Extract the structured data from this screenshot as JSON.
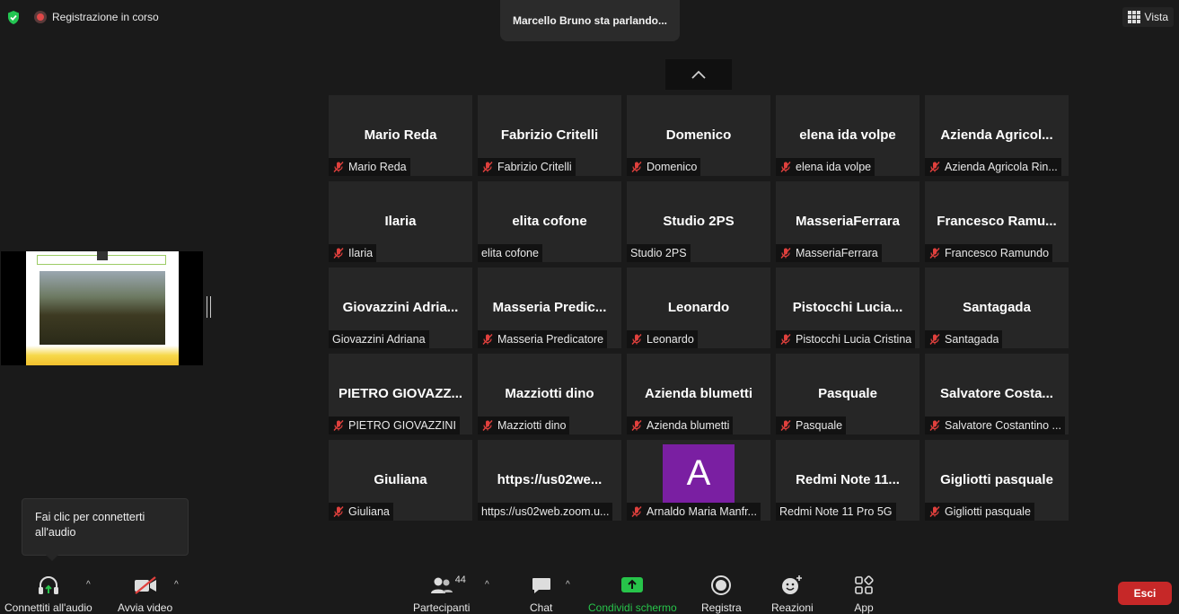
{
  "header": {
    "recording_label": "Registrazione in corso",
    "speaking_banner": "Marcello Bruno sta parlando...",
    "view_label": "Vista"
  },
  "tiles": [
    {
      "big": "Mario Reda",
      "label": "Mario Reda",
      "muted": true
    },
    {
      "big": "Fabrizio Critelli",
      "label": "Fabrizio Critelli",
      "muted": true
    },
    {
      "big": "Domenico",
      "label": "Domenico",
      "muted": true
    },
    {
      "big": "elena ida volpe",
      "label": "elena ida volpe",
      "muted": true
    },
    {
      "big": "Azienda Agricol...",
      "label": "Azienda Agricola Rin...",
      "muted": true
    },
    {
      "big": "Ilaria",
      "label": "Ilaria",
      "muted": true
    },
    {
      "big": "elita cofone",
      "label": "elita cofone",
      "muted": false
    },
    {
      "big": "Studio 2PS",
      "label": "Studio 2PS",
      "muted": false
    },
    {
      "big": "MasseriaFerrara",
      "label": "MasseriaFerrara",
      "muted": true
    },
    {
      "big": "Francesco Ramu...",
      "label": "Francesco Ramundo",
      "muted": true
    },
    {
      "big": "Giovazzini Adria...",
      "label": "Giovazzini Adriana",
      "muted": false
    },
    {
      "big": "Masseria Predic...",
      "label": "Masseria Predicatore",
      "muted": true
    },
    {
      "big": "Leonardo",
      "label": "Leonardo",
      "muted": true
    },
    {
      "big": "Pistocchi Lucia...",
      "label": "Pistocchi Lucia Cristina",
      "muted": true
    },
    {
      "big": "Santagada",
      "label": "Santagada",
      "muted": true
    },
    {
      "big": "PIETRO GIOVAZZ...",
      "label": "PIETRO GIOVAZZINI",
      "muted": true
    },
    {
      "big": "Mazziotti dino",
      "label": "Mazziotti dino",
      "muted": true
    },
    {
      "big": "Azienda blumetti",
      "label": "Azienda blumetti",
      "muted": true
    },
    {
      "big": "Pasquale",
      "label": "Pasquale",
      "muted": true
    },
    {
      "big": "Salvatore Costa...",
      "label": "Salvatore Costantino ...",
      "muted": true
    },
    {
      "big": "Giuliana",
      "label": "Giuliana",
      "muted": true
    },
    {
      "big": "https://us02we...",
      "label": "https://us02web.zoom.u...",
      "muted": false
    },
    {
      "big": "",
      "avatar": "A",
      "label": "Arnaldo Maria Manfr...",
      "muted": true
    },
    {
      "big": "Redmi Note 11...",
      "label": "Redmi Note 11 Pro 5G",
      "muted": false
    },
    {
      "big": "Gigliotti pasquale",
      "label": "Gigliotti pasquale",
      "muted": true
    }
  ],
  "tooltip": {
    "text": "Fai clic per connetterti all'audio"
  },
  "toolbar": {
    "audio_label": "Connettiti all'audio",
    "video_label": "Avvia video",
    "participants_label": "Partecipanti",
    "participants_count": "44",
    "chat_label": "Chat",
    "share_label": "Condividi schermo",
    "record_label": "Registra",
    "reactions_label": "Reazioni",
    "apps_label": "App",
    "exit_label": "Esci"
  },
  "colors": {
    "background": "#1a1a1a",
    "tile": "#262626",
    "muted_red": "#e0403d",
    "share_green": "#27c44a",
    "exit_red": "#c62828",
    "avatar_purple": "#7a1fa2"
  }
}
